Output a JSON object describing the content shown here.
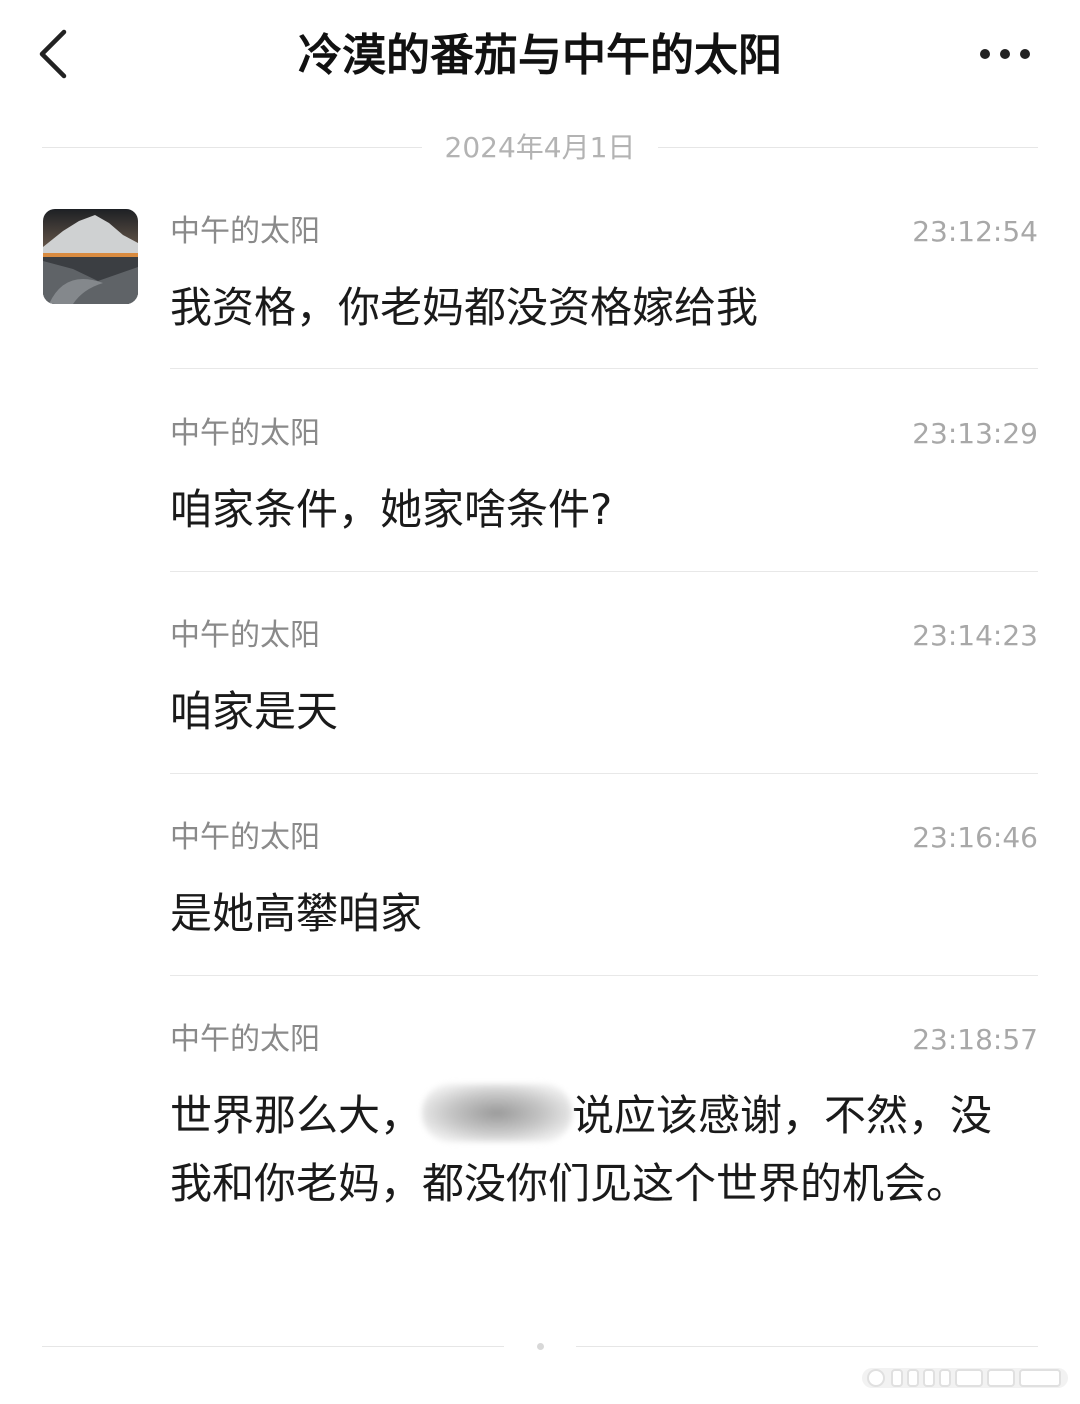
{
  "header": {
    "title": "冷漠的番茄与中午的太阳",
    "back_icon": "chevron-left-icon",
    "more_icon": "more-horizontal-icon"
  },
  "date_separator": "2024年4月1日",
  "messages": [
    {
      "sender": "中午的太阳",
      "time": "23:12:54",
      "text": "我资格，你老妈都没资格嫁给我"
    },
    {
      "sender": "中午的太阳",
      "time": "23:13:29",
      "text": "咱家条件，她家啥条件?"
    },
    {
      "sender": "中午的太阳",
      "time": "23:14:23",
      "text": "咱家是天"
    },
    {
      "sender": "中午的太阳",
      "time": "23:16:46",
      "text": "是她高攀咱家"
    },
    {
      "sender": "中午的太阳",
      "time": "23:18:57",
      "text_before": "世界那么大，",
      "text_after": "说应该感谢，不然，没我和你老妈，都没你们见这个世界的机会。"
    }
  ],
  "colors": {
    "title": "#111111",
    "sender": "#8a8a8a",
    "time": "#a8a8a8",
    "message": "#1a1a1a",
    "divider": "#e8e8e8"
  }
}
